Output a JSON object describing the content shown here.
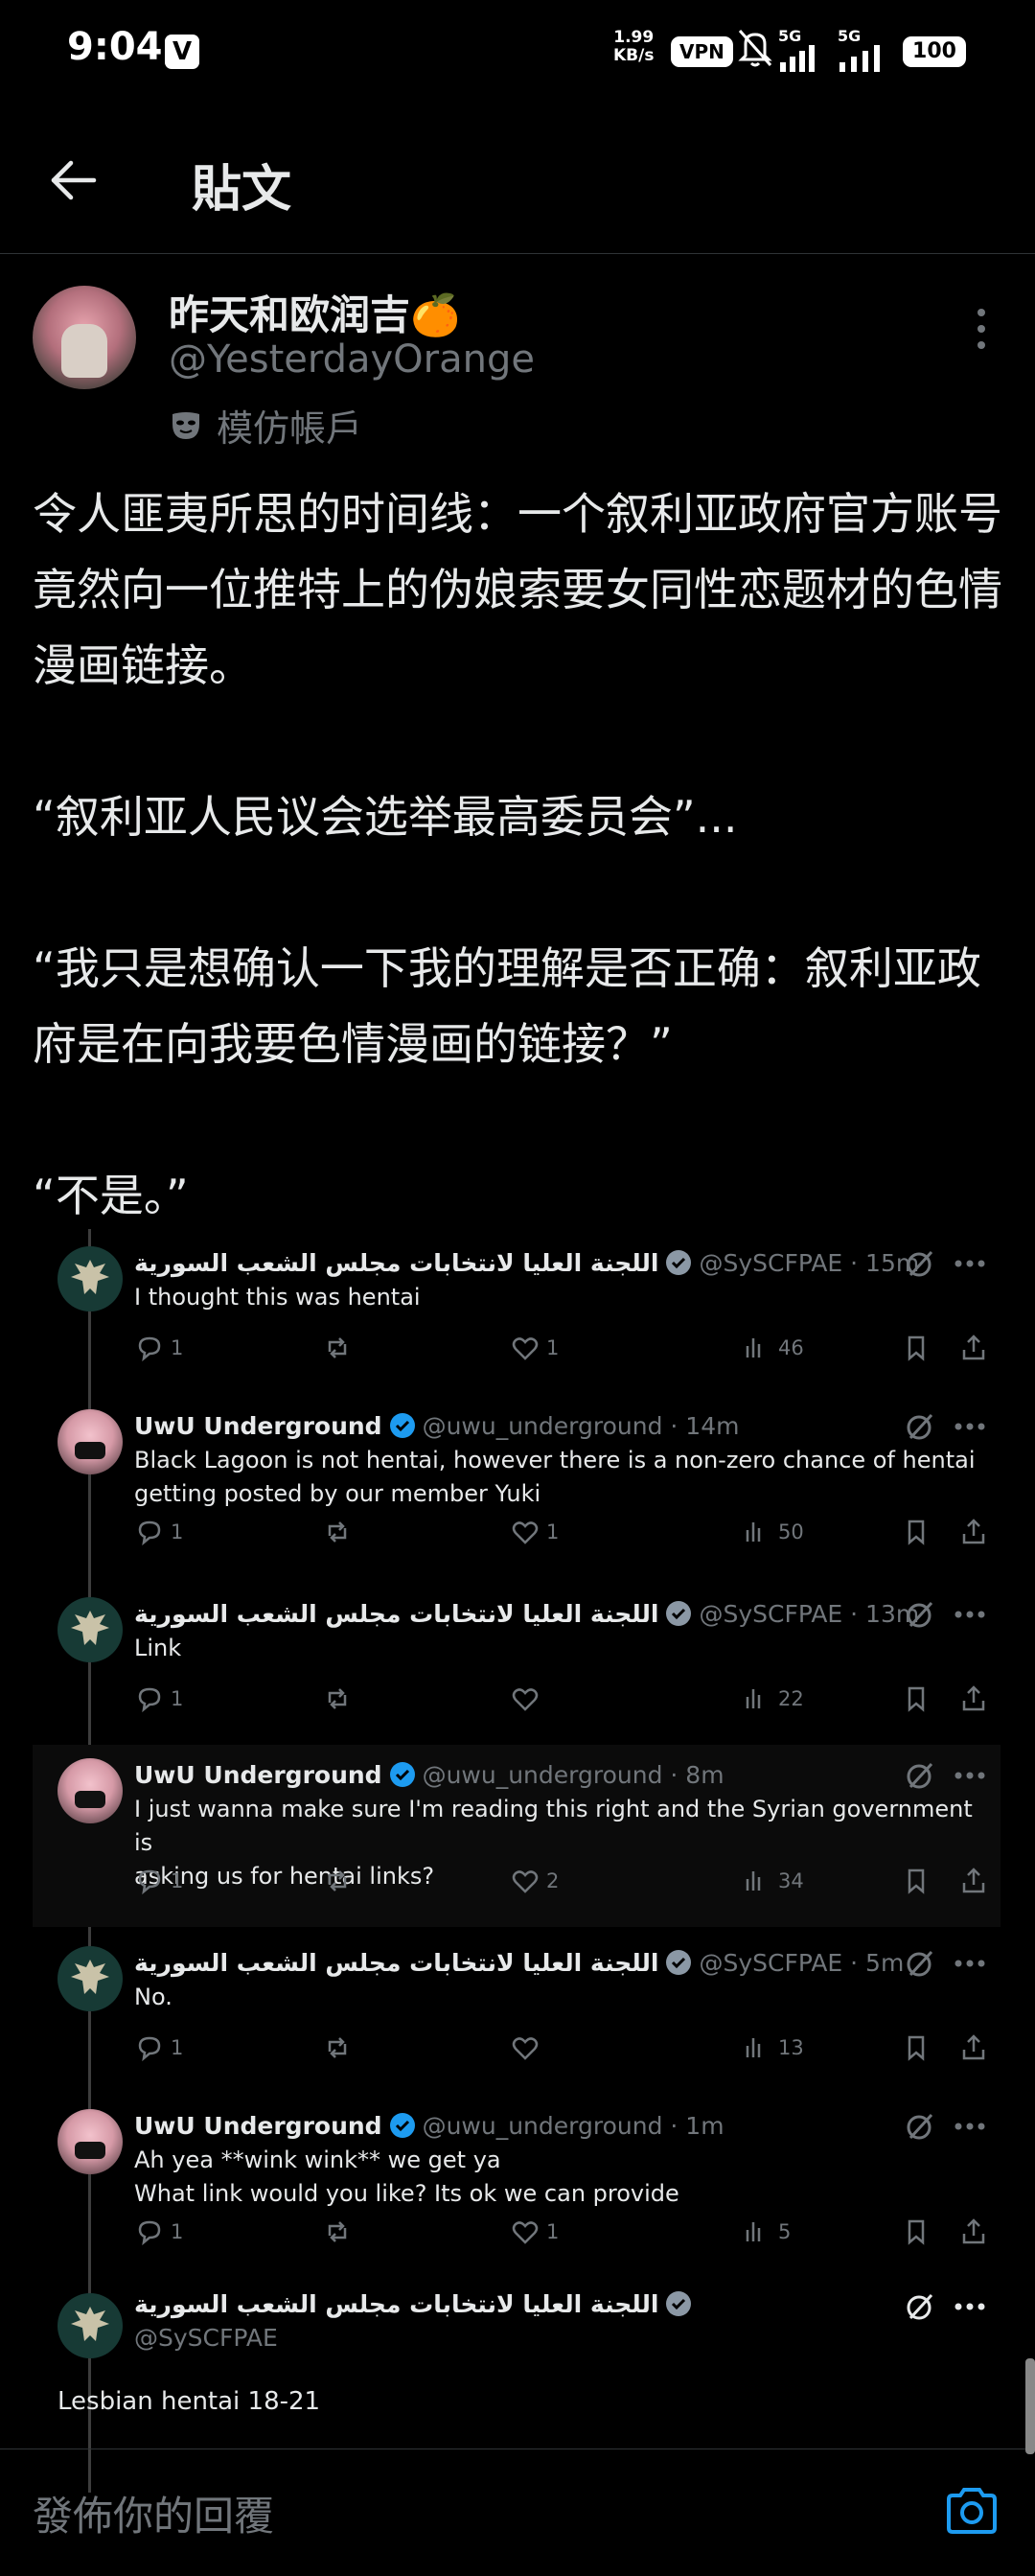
{
  "status_bar": {
    "time": "9:04",
    "v_badge": "V",
    "speed_value": "1.99",
    "speed_unit": "KB/s",
    "vpn": "VPN",
    "net1": "5G",
    "net2": "5G",
    "battery": "100"
  },
  "header": {
    "title": "貼文"
  },
  "author": {
    "name": "昨天和欧润吉🍊",
    "handle": "@YesterdayOrange",
    "parody_label": "模仿帳戶"
  },
  "tweet_text": "令人匪夷所思的时间线：一个叙利亚政府官方账号竟然向一位推特上的伪娘索要女同性恋题材的色情漫画链接。\n\n“叙利亚人民议会选举最高委员会”...\n\n“我只是想确认一下我的理解是否正确：叙利亚政府是在向我要色情漫画的链接？”\n\n“不是。”",
  "replies": [
    {
      "name": "اللجنة العليا لانتخابات مجلس الشعب السورية",
      "handle_time": "@SySCFPAE · 15m",
      "text": "I thought this was hentai",
      "replies": "1",
      "likes": "1",
      "views": "46",
      "avatar": "gov"
    },
    {
      "name": "UwU Underground",
      "handle_time": "@uwu_underground · 14m",
      "text": "Black Lagoon is not hentai, however there is a non-zero chance of hentai\ngetting posted by our member Yuki",
      "replies": "1",
      "likes": "1",
      "views": "50",
      "avatar": "uwu"
    },
    {
      "name": "اللجنة العليا لانتخابات مجلس الشعب السورية",
      "handle_time": "@SySCFPAE · 13m",
      "text": "Link",
      "replies": "1",
      "likes": "",
      "views": "22",
      "avatar": "gov"
    },
    {
      "name": "UwU Underground",
      "handle_time": "@uwu_underground · 8m",
      "text": "I just wanna make sure I'm reading this right and the Syrian government is\nasking us for hentai links?",
      "replies": "1",
      "likes": "2",
      "views": "34",
      "avatar": "uwu"
    },
    {
      "name": "اللجنة العليا لانتخابات مجلس الشعب السورية",
      "handle_time": "@SySCFPAE · 5m",
      "text": "No.",
      "replies": "1",
      "likes": "",
      "views": "13",
      "avatar": "gov"
    },
    {
      "name": "UwU Underground",
      "handle_time": "@uwu_underground · 1m",
      "text": "Ah yea **wink wink** we get ya\nWhat link would you like? Its ok we can provide",
      "replies": "1",
      "likes": "1",
      "views": "5",
      "avatar": "uwu"
    }
  ],
  "final_reply": {
    "name": "اللجنة العليا لانتخابات مجلس الشعب السورية",
    "handle": "@SySCFPAE",
    "text": "Lesbian hentai 18-21"
  },
  "reply_box": {
    "placeholder": "發佈你的回覆"
  },
  "colors": {
    "background": "#000000",
    "text": "#e7e9ea",
    "muted": "#71767b",
    "verified": "#1d9bf0"
  }
}
